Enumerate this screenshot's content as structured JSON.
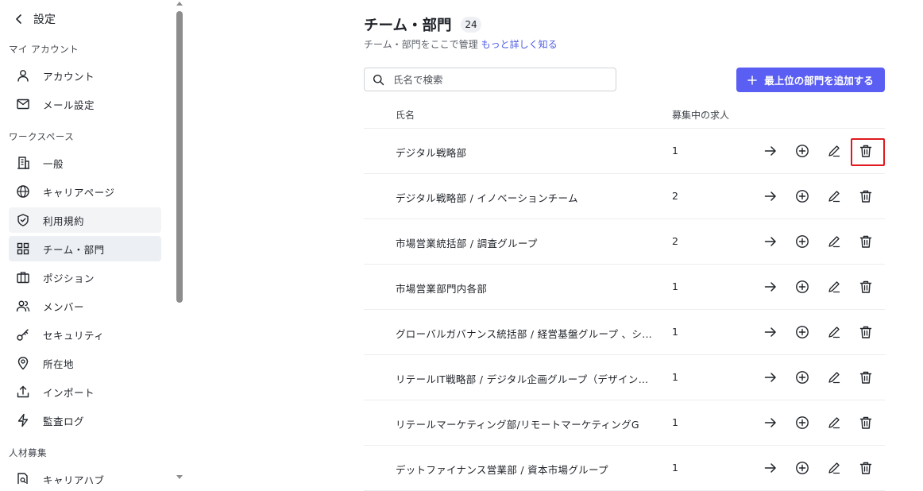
{
  "sidebar": {
    "back_label": "設定",
    "sections": {
      "account": "マイ アカウント",
      "workspace": "ワークスペース",
      "recruiting": "人材募集"
    },
    "items": {
      "account": "アカウント",
      "mail": "メール設定",
      "general": "一般",
      "career_page": "キャリアページ",
      "terms": "利用規約",
      "teams": "チーム・部門",
      "positions": "ポジション",
      "members": "メンバー",
      "security": "セキュリティ",
      "locations": "所在地",
      "import": "インポート",
      "audit_log": "監査ログ",
      "career_hub": "キャリアハブ"
    }
  },
  "main": {
    "title": "チーム・部門",
    "count": "24",
    "subtitle": "チーム・部門をここで管理",
    "learn_more": "もっと詳しく知る",
    "search_placeholder": "氏名で検索",
    "add_button": "最上位の部門を追加する",
    "columns": {
      "name": "氏名",
      "open_jobs": "募集中の求人"
    },
    "rows": [
      {
        "name": "デジタル戦略部",
        "jobs": "1"
      },
      {
        "name": "デジタル戦略部 / イノベーションチーム",
        "jobs": "2"
      },
      {
        "name": "市場営業統括部 / 調査グループ",
        "jobs": "2"
      },
      {
        "name": "市場営業部門内各部",
        "jobs": "1"
      },
      {
        "name": "グローバルガバナンス統括部 / 経営基盤グループ 、シ…",
        "jobs": "1"
      },
      {
        "name": "リテールIT戦略部 / デジタル企画グループ（デザイン…",
        "jobs": "1"
      },
      {
        "name": "リテールマーケティング部/リモートマーケティングG",
        "jobs": "1"
      },
      {
        "name": "デットファイナンス営業部 / 資本市場グループ",
        "jobs": "1"
      }
    ]
  },
  "colors": {
    "accent": "#5b5ef2",
    "link": "#4e5de6",
    "focus_outline": "#e0191f",
    "active_bg": "#eceff4"
  }
}
